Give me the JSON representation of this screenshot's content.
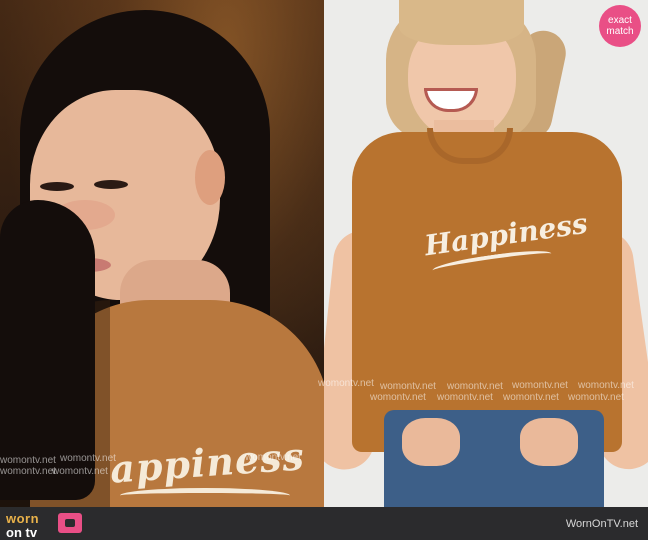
{
  "badge": {
    "line1": "exact",
    "line2": "match"
  },
  "left_shirt_text": "appiness",
  "right_shirt_text": "Happiness",
  "watermark": "womontv.net",
  "footer": {
    "logo_top": "worn",
    "logo_bottom": "on tv",
    "site": "WornOnTV.net"
  },
  "colors": {
    "badge": "#e94f86",
    "logo_accent": "#e9b24a",
    "shirt": "#b8783e",
    "footer_bg": "#2b2b2d"
  },
  "icons": [
    "tv-icon"
  ]
}
